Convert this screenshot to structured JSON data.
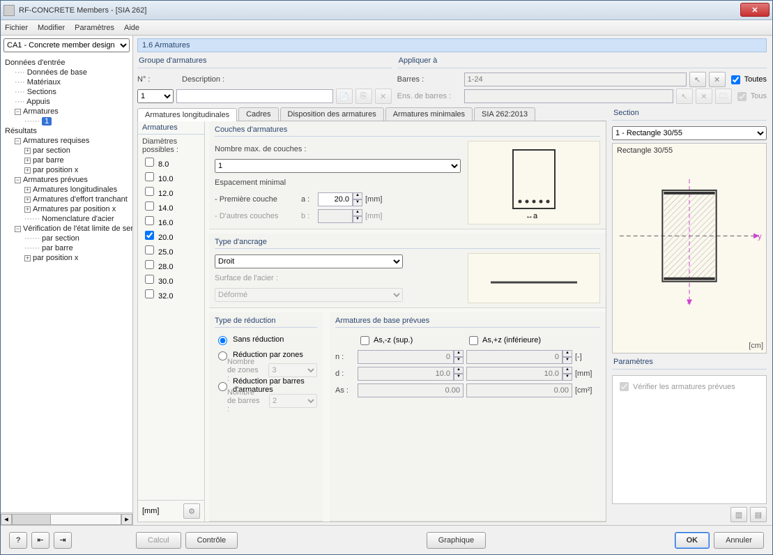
{
  "window": {
    "title": "RF-CONCRETE Members - [SIA 262]"
  },
  "menu": {
    "file": "Fichier",
    "modify": "Modifier",
    "params": "Paramètres",
    "help": "Aide"
  },
  "case_combo": "CA1 - Concrete member design",
  "tree": {
    "input": "Données d'entrée",
    "base": "Données de base",
    "materials": "Matériaux",
    "sections": "Sections",
    "supports": "Appuis",
    "rebar": "Armatures",
    "badge": "1",
    "results": "Résultats",
    "required": "Armatures requises",
    "by_section": "par section",
    "by_bar": "par barre",
    "by_posx": "par position x",
    "provided": "Armatures prévues",
    "long": "Armatures longitudinales",
    "shear": "Armatures d'effort tranchant",
    "posx2": "Armatures par position x",
    "nomen": "Nomenclature d'acier",
    "sls": "Vérification de l'état limite de service",
    "sls_sec": "par section",
    "sls_bar": "par barre",
    "sls_pos": "par position x"
  },
  "page": {
    "title": "1.6 Armatures"
  },
  "grp_arm": {
    "title": "Groupe d'armatures",
    "no": "N° :",
    "desc": "Description :",
    "no_val": "1"
  },
  "apply": {
    "title": "Appliquer à",
    "bars": "Barres :",
    "sets": "Ens. de barres :",
    "bars_val": "1-24",
    "all": "Toutes",
    "all2": "Tous"
  },
  "tabs": {
    "t1": "Armatures longitudinales",
    "t2": "Cadres",
    "t3": "Disposition des armatures",
    "t4": "Armatures minimales",
    "t5": "SIA 262:2013"
  },
  "arm": {
    "title": "Armatures",
    "diam": "Diamètres possibles :",
    "list": [
      "8.0",
      "10.0",
      "12.0",
      "14.0",
      "16.0",
      "20.0",
      "25.0",
      "28.0",
      "30.0",
      "32.0"
    ],
    "checked": "20.0",
    "unit": "[mm]"
  },
  "layers": {
    "title": "Couches d'armatures",
    "max": "Nombre max. de couches :",
    "max_val": "1",
    "spacing": "Espacement minimal",
    "first": "- Première couche",
    "other": "- D'autres couches",
    "a": "a :",
    "b": "b :",
    "a_val": "20.0",
    "b_val": "",
    "mm": "[mm]"
  },
  "anchor": {
    "title": "Type d'ancrage",
    "val": "Droit",
    "surface": "Surface de l'acier :",
    "surface_val": "Déformé"
  },
  "reduction": {
    "title": "Type de réduction",
    "none": "Sans réduction",
    "zones": "Réduction par zones",
    "nzones": "Nombre de zones :",
    "nzones_val": "3",
    "bars": "Réduction par barres d'armatures",
    "nbars": "Nombre de barres :",
    "nbars_val": "2"
  },
  "basic": {
    "title": "Armatures de base prévues",
    "top": "As,-z (sup.)",
    "bot": "As,+z (inférieure)",
    "n": "n :",
    "d": "d :",
    "As": "As :",
    "n_top": "0",
    "n_bot": "0",
    "d_top": "10.0",
    "d_bot": "10.0",
    "As_top": "0.00",
    "As_bot": "0.00",
    "u_count": "[-]",
    "u_mm": "[mm]",
    "u_cm2": "[cm²]"
  },
  "section": {
    "title": "Section",
    "sel": "1 - Rectangle 30/55",
    "name": "Rectangle 30/55",
    "unit": "[cm]"
  },
  "params": {
    "title": "Paramètres",
    "verify": "Vérifier les armatures prévues"
  },
  "footer": {
    "calc": "Calcul",
    "check": "Contrôle",
    "graph": "Graphique",
    "ok": "OK",
    "cancel": "Annuler"
  }
}
